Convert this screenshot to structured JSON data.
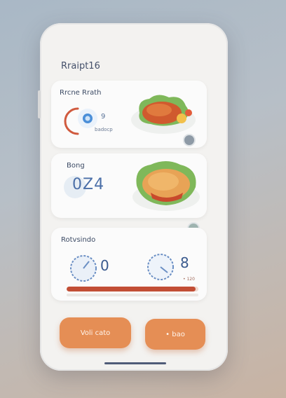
{
  "header": {
    "title": "Rraipt16"
  },
  "card1": {
    "title": "Rrcne Rrath",
    "dial_value": "9",
    "dial_caption": "badocp"
  },
  "card2": {
    "title": "Bong",
    "value": "0Ζ4"
  },
  "card3": {
    "title": "Rotvsindo",
    "gauge_left_value": "0",
    "gauge_right_value": "8",
    "progress_caption": "• 120",
    "progress_level": 0.98
  },
  "actions": {
    "primary_label": "Voli cato",
    "secondary_label": "• bao"
  },
  "colors": {
    "accent": "#e58e55",
    "progress": "#c24e35",
    "dial_blue": "#4b8fd8"
  }
}
